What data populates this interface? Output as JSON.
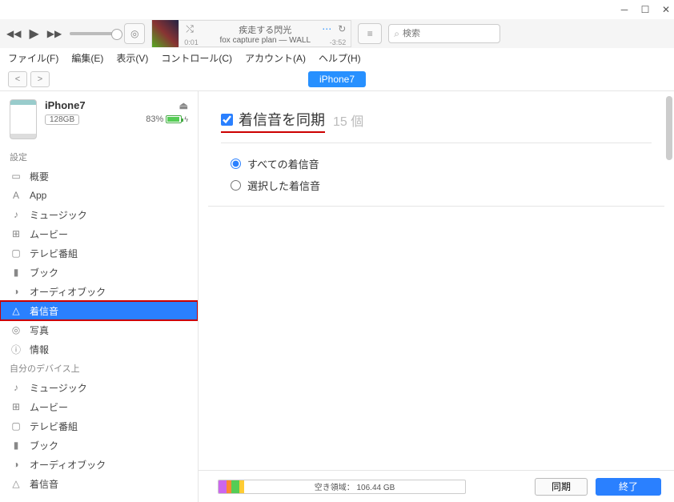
{
  "menubar": {
    "file": "ファイル(F)",
    "edit": "編集(E)",
    "view": "表示(V)",
    "control": "コントロール(C)",
    "account": "アカウント(A)",
    "help": "ヘルプ(H)"
  },
  "nowplaying": {
    "title": "疾走する閃光",
    "artist": "fox capture plan — WALL",
    "elapsed": "0:01",
    "remaining": "-3:52"
  },
  "search": {
    "placeholder": "検索"
  },
  "device_tab": "iPhone7",
  "device": {
    "name": "iPhone7",
    "capacity": "128GB",
    "battery": "83%"
  },
  "sections": {
    "settings": "設定",
    "on_device": "自分のデバイス上"
  },
  "settings_items": [
    {
      "icon": "summary-icon",
      "glyph": "▭",
      "label": "概要"
    },
    {
      "icon": "apps-icon",
      "glyph": "A",
      "label": "App"
    },
    {
      "icon": "music-icon",
      "glyph": "♪",
      "label": "ミュージック"
    },
    {
      "icon": "movies-icon",
      "glyph": "⊞",
      "label": "ムービー"
    },
    {
      "icon": "tv-icon",
      "glyph": "▢",
      "label": "テレビ番組"
    },
    {
      "icon": "books-icon",
      "glyph": "▮",
      "label": "ブック"
    },
    {
      "icon": "audiobooks-icon",
      "glyph": "◑",
      "label": "オーディオブック"
    },
    {
      "icon": "ringtones-icon",
      "glyph": "△",
      "label": "着信音",
      "selected": true,
      "boxed": true
    },
    {
      "icon": "photos-icon",
      "glyph": "◎",
      "label": "写真"
    },
    {
      "icon": "info-icon",
      "glyph": "ⓘ",
      "label": "情報"
    }
  ],
  "device_items": [
    {
      "icon": "music-icon",
      "glyph": "♪",
      "label": "ミュージック"
    },
    {
      "icon": "movies-icon",
      "glyph": "⊞",
      "label": "ムービー"
    },
    {
      "icon": "tv-icon",
      "glyph": "▢",
      "label": "テレビ番組"
    },
    {
      "icon": "books-icon",
      "glyph": "▮",
      "label": "ブック"
    },
    {
      "icon": "audiobooks-icon",
      "glyph": "◑",
      "label": "オーディオブック"
    },
    {
      "icon": "ringtones-icon",
      "glyph": "△",
      "label": "着信音"
    }
  ],
  "sync": {
    "label": "着信音を同期",
    "count": "15 個",
    "radio_all": "すべての着信音",
    "radio_selected": "選択した着信音"
  },
  "storage": {
    "free_label": "空き領域：",
    "free_value": "106.44 GB"
  },
  "buttons": {
    "sync": "同期",
    "done": "終了"
  }
}
